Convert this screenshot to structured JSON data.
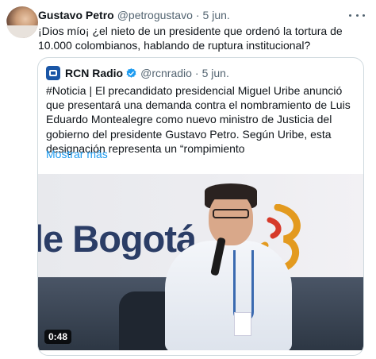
{
  "tweet": {
    "author_name": "Gustavo Petro",
    "author_handle": "@petrogustavo",
    "separator": "·",
    "date": "5 jun.",
    "text": "¡Dios mío¡ ¿el nieto de un presidente que ordenó la tortura de 10.000 colombianos, hablando de ruptura institucional?"
  },
  "quote": {
    "author_name": "RCN Radio",
    "author_handle": "@rcnradio",
    "separator": "·",
    "date": "5 jun.",
    "verified_icon": "verified-badge-icon",
    "text": "#Noticia | El precandidato presidencial Miguel Uribe anunció que presentará una demanda contra el nombramiento de Luis Eduardo Montealegre como nuevo ministro de Justicia del gobierno del presidente Gustavo Petro. Según Uribe, esta designación representa un “rompimiento",
    "show_more": "Mostrar más"
  },
  "video": {
    "backdrop_text": "le Bogotá",
    "duration": "0:48"
  },
  "colors": {
    "link": "#1d9bf0",
    "secondary": "#536471",
    "border": "#cfd9de",
    "verified": "#1d9bf0"
  }
}
